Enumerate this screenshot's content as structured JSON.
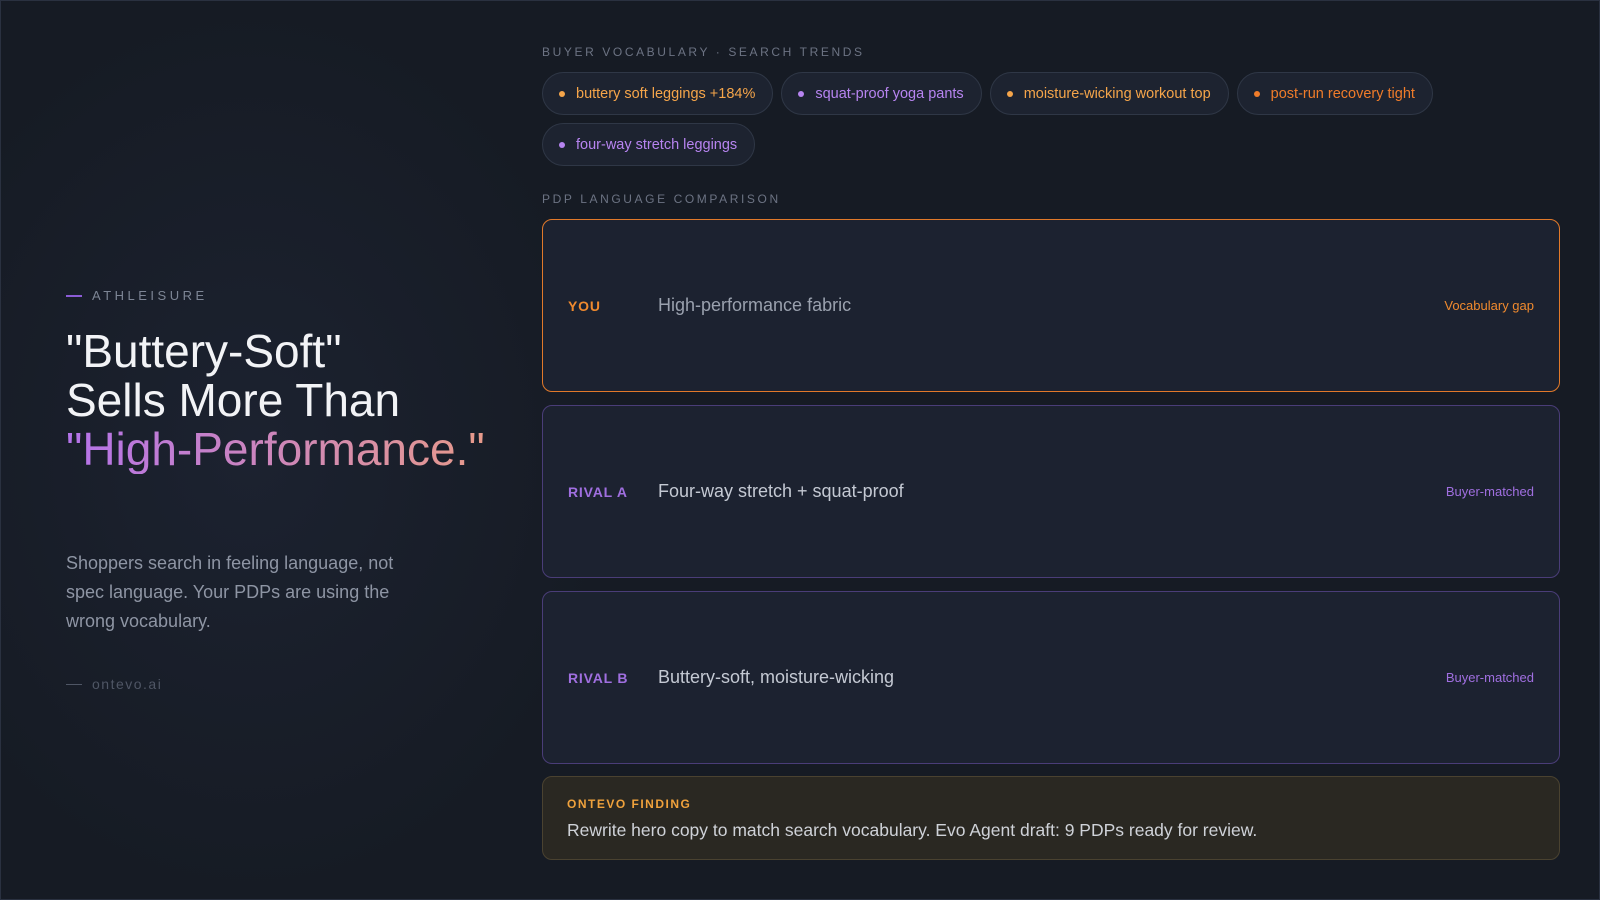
{
  "left": {
    "eyebrow": "ATHLEISURE",
    "headline_line1": "\"Buttery-Soft\"",
    "headline_line2": "Sells More Than",
    "headline_accent": "\"High-Performance.\"",
    "subtext": "Shoppers search in feeling language, not spec language. Your PDPs are using the wrong vocabulary.",
    "signoff": "ontevo.ai"
  },
  "trends": {
    "label": "BUYER VOCABULARY · SEARCH TRENDS",
    "chips": [
      {
        "text": "buttery soft leggings +184%",
        "color": "#f5a54a"
      },
      {
        "text": "squat-proof yoga pants",
        "color": "#b784f0"
      },
      {
        "text": "moisture-wicking workout top",
        "color": "#f5a54a"
      },
      {
        "text": "post-run recovery tight",
        "color": "#f07c2a"
      },
      {
        "text": "four-way stretch leggings",
        "color": "#b784f0"
      }
    ]
  },
  "comparison": {
    "label": "PDP LANGUAGE COMPARISON",
    "rows": [
      {
        "tag": "YOU",
        "copy": "High-performance fabric",
        "status": "Vocabulary gap"
      },
      {
        "tag": "RIVAL A",
        "copy": "Four-way stretch + squat-proof",
        "status": "Buyer-matched"
      },
      {
        "tag": "RIVAL B",
        "copy": "Buttery-soft, moisture-wicking",
        "status": "Buyer-matched"
      }
    ]
  },
  "finding": {
    "label": "ONTEVO FINDING",
    "text": "Rewrite hero copy to match search vocabulary. Evo Agent draft: 9 PDPs ready for review."
  }
}
